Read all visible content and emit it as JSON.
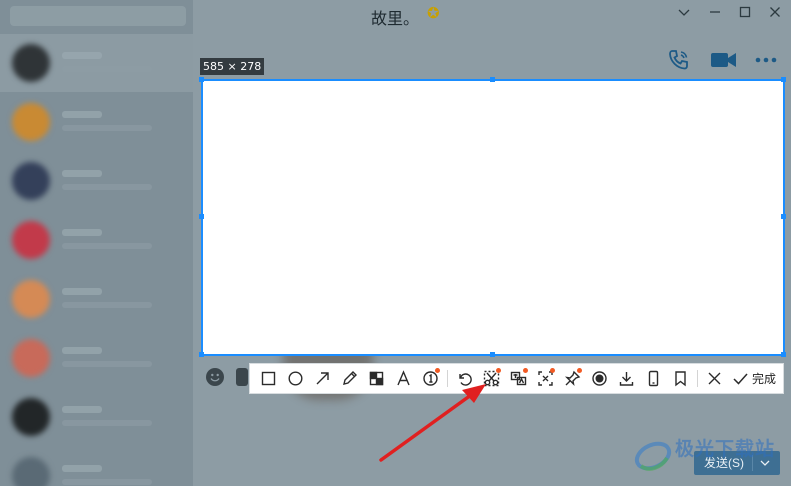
{
  "window": {
    "title": "故里。",
    "star_color": "#c8a000"
  },
  "sidebar": {
    "items": [
      {
        "avatar_color": "#2f3437",
        "active": true
      },
      {
        "avatar_color": "#c98a33"
      },
      {
        "avatar_color": "#34405a"
      },
      {
        "avatar_color": "#c23a4a"
      },
      {
        "avatar_color": "#d58a55"
      },
      {
        "avatar_color": "#c86a5a"
      },
      {
        "avatar_color": "#222628"
      },
      {
        "avatar_color": "#5a6a75"
      }
    ]
  },
  "selection": {
    "size_label": "585 × 278",
    "border_color": "#1a8dff"
  },
  "toolbar": {
    "tools": [
      {
        "name": "rectangle-tool",
        "icon": "rectangle-icon",
        "dot": false
      },
      {
        "name": "ellipse-tool",
        "icon": "circle-icon",
        "dot": false
      },
      {
        "name": "arrow-tool",
        "icon": "arrow-icon",
        "dot": false
      },
      {
        "name": "pen-tool",
        "icon": "pencil-icon",
        "dot": false
      },
      {
        "name": "mosaic-tool",
        "icon": "mosaic-icon",
        "dot": false
      },
      {
        "name": "text-tool",
        "icon": "text-icon",
        "dot": false
      },
      {
        "name": "number-tool",
        "icon": "number-icon",
        "dot": true
      },
      {
        "name": "undo-tool",
        "icon": "undo-icon",
        "dot": false
      },
      {
        "name": "scissors-tool",
        "icon": "scissors-icon",
        "dot": true
      },
      {
        "name": "translate-tool",
        "icon": "translate-icon",
        "dot": true
      },
      {
        "name": "text-recognition-tool",
        "icon": "ocr-icon",
        "dot": true
      },
      {
        "name": "pin-tool",
        "icon": "pin-icon",
        "dot": true
      },
      {
        "name": "record-tool",
        "icon": "record-icon",
        "dot": false
      },
      {
        "name": "download-tool",
        "icon": "download-icon",
        "dot": false
      },
      {
        "name": "phone-tool",
        "icon": "phone-icon",
        "dot": false
      },
      {
        "name": "bookmark-tool",
        "icon": "bookmark-icon",
        "dot": false
      },
      {
        "name": "close-tool",
        "icon": "close-icon",
        "dot": false
      }
    ],
    "done_label": "完成",
    "dot_color": "#f25a23"
  },
  "composer": {
    "send_label": "发送(S)"
  },
  "watermark": {
    "text": "极光下载站"
  },
  "annotation": {
    "arrow_color": "#e02020"
  }
}
